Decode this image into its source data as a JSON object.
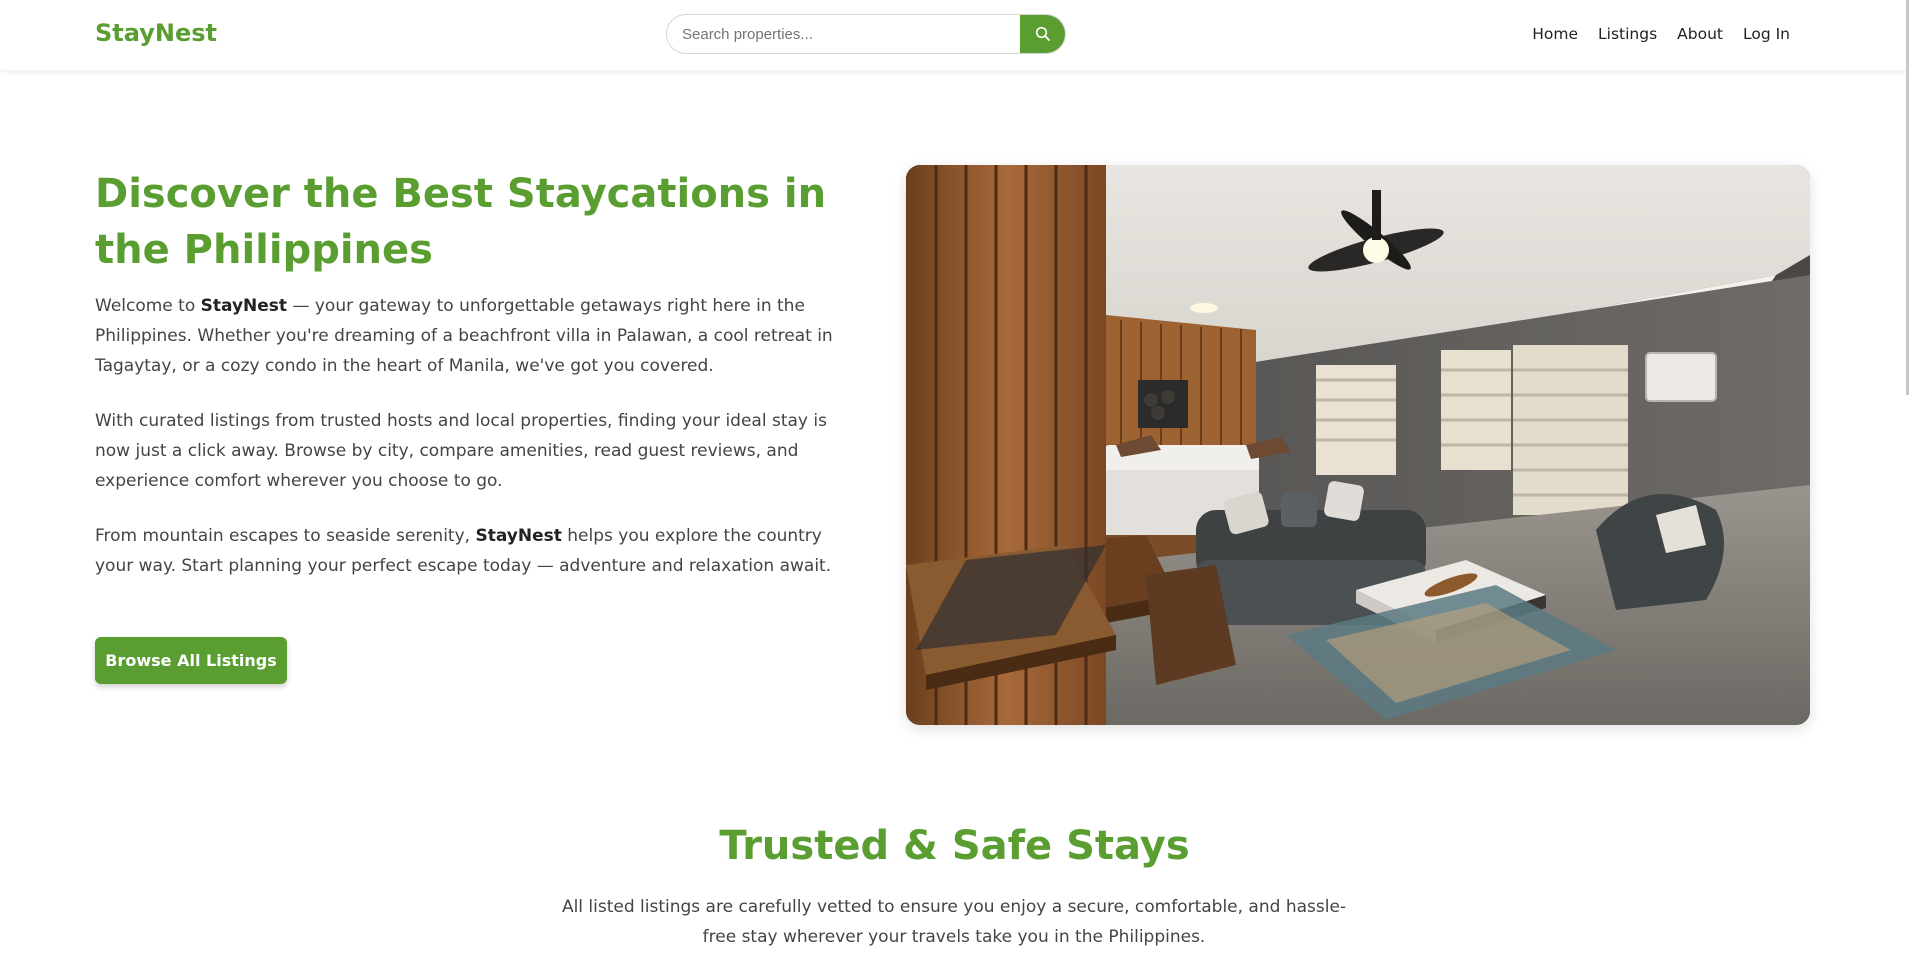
{
  "header": {
    "brand": "StayNest",
    "search_placeholder": "Search properties...",
    "search_icon": "search-icon",
    "nav": [
      "Home",
      "Listings",
      "About",
      "Log In"
    ]
  },
  "hero": {
    "title": "Discover the Best Staycations in the Philippines",
    "p1": {
      "a": "Welcome to ",
      "b": "StayNest",
      "c": " — your gateway to unforgettable getaways right here in the Philippines. Whether you're dreaming of a beachfront villa in Palawan, a cool retreat in Tagaytay, or a cozy condo in the heart of Manila, we've got you covered."
    },
    "p2": "With curated listings from trusted hosts and local properties, finding your ideal stay is now just a click away. Browse by city, compare amenities, read guest reviews, and experience comfort wherever you choose to go.",
    "p3": {
      "a": "From mountain escapes to seaside serenity, ",
      "b": "StayNest",
      "c": " helps you explore the country your way. Start planning your perfect escape today — adventure and relaxation await."
    },
    "cta": "Browse All Listings"
  },
  "trusted": {
    "title": "Trusted & Safe Stays",
    "text": "All listed listings are carefully vetted to ensure you enjoy a secure, comfortable, and hassle-free stay wherever your travels take you in the Philippines."
  },
  "colors": {
    "brand_green": "#5a9e32",
    "text": "#444444"
  }
}
